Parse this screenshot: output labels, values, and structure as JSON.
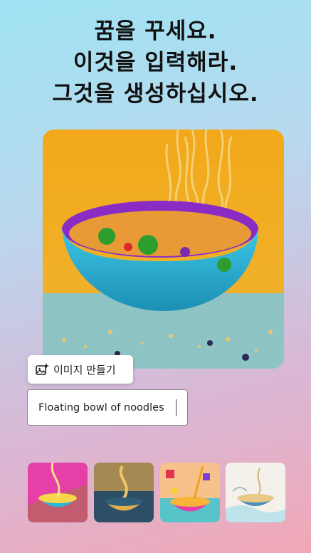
{
  "headline": {
    "line1": "꿈을 꾸세요.",
    "line2": "이것을 입력해라.",
    "line3": "그것을 생성하십시오."
  },
  "hero_image": {
    "subject": "noodle-bowl-image"
  },
  "make_image_button": {
    "label": "이미지 만들기",
    "icon": "image-sparkle-icon"
  },
  "prompt_field": {
    "value": "Floating bowl of noodles"
  },
  "thumbnails": [
    {
      "name": "thumbnail-pop-art"
    },
    {
      "name": "thumbnail-golden"
    },
    {
      "name": "thumbnail-colorful-blocks"
    },
    {
      "name": "thumbnail-sketch"
    }
  ],
  "colors": {
    "bowl_outer": "#2ab6d8",
    "bowl_inner": "#8a2cc4",
    "background_warm": "#f2a81a"
  }
}
